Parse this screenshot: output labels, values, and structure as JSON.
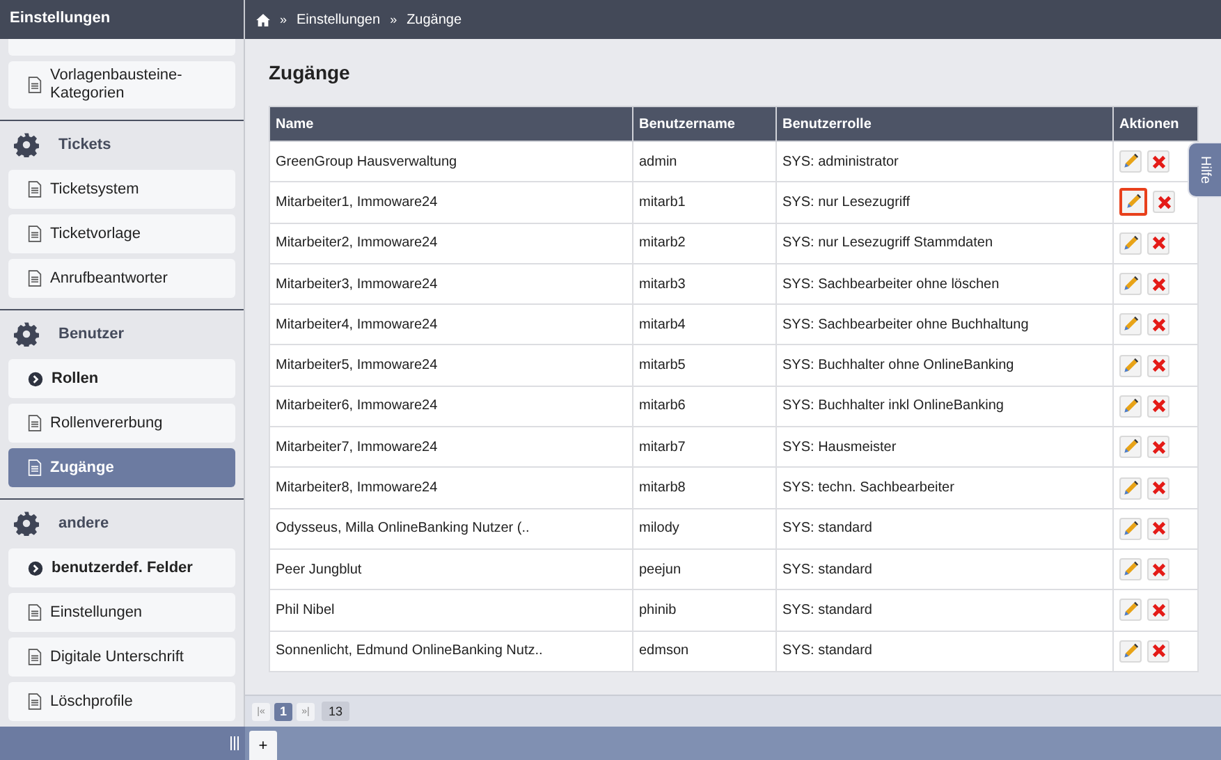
{
  "sidebar": {
    "title": "Einstellungen",
    "groups": [
      {
        "items": [
          {
            "kind": "doc",
            "label": "Vorlagenbausteine-Kategorien",
            "selected": false
          }
        ]
      },
      {
        "label": "Tickets",
        "items": [
          {
            "kind": "doc",
            "label": "Ticketsystem",
            "selected": false
          },
          {
            "kind": "doc",
            "label": "Ticketvorlage",
            "selected": false
          },
          {
            "kind": "doc",
            "label": "Anrufbeantworter",
            "selected": false
          }
        ]
      },
      {
        "label": "Benutzer",
        "items": [
          {
            "kind": "sub",
            "label": "Rollen",
            "selected": false
          },
          {
            "kind": "doc",
            "label": "Rollenvererbung",
            "selected": false
          },
          {
            "kind": "doc",
            "label": "Zugänge",
            "selected": true
          }
        ]
      },
      {
        "label": "andere",
        "items": [
          {
            "kind": "sub",
            "label": "benutzerdef. Felder",
            "selected": false
          },
          {
            "kind": "doc",
            "label": "Einstellungen",
            "selected": false
          },
          {
            "kind": "doc",
            "label": "Digitale Unterschrift",
            "selected": false
          },
          {
            "kind": "doc",
            "label": "Löschprofile",
            "selected": false
          }
        ]
      }
    ]
  },
  "breadcrumb": [
    "Einstellungen",
    "Zugänge"
  ],
  "breadcrumb_separator": "»",
  "page_title": "Zugänge",
  "help_tab": "Hilfe",
  "table": {
    "columns": [
      "Name",
      "Benutzername",
      "Benutzerrolle",
      "Aktionen"
    ],
    "rows": [
      {
        "name": "GreenGroup Hausverwaltung",
        "username": "admin",
        "role": "SYS: administrator",
        "edit_focused": false
      },
      {
        "name": "Mitarbeiter1, Immoware24",
        "username": "mitarb1",
        "role": "SYS: nur Lesezugriff",
        "edit_focused": true
      },
      {
        "name": "Mitarbeiter2, Immoware24",
        "username": "mitarb2",
        "role": "SYS: nur Lesezugriff Stammdaten",
        "edit_focused": false
      },
      {
        "name": "Mitarbeiter3, Immoware24",
        "username": "mitarb3",
        "role": "SYS: Sachbearbeiter ohne löschen",
        "edit_focused": false
      },
      {
        "name": "Mitarbeiter4, Immoware24",
        "username": "mitarb4",
        "role": "SYS: Sachbearbeiter ohne Buchhaltung",
        "edit_focused": false
      },
      {
        "name": "Mitarbeiter5, Immoware24",
        "username": "mitarb5",
        "role": "SYS: Buchhalter ohne OnlineBanking",
        "edit_focused": false
      },
      {
        "name": "Mitarbeiter6, Immoware24",
        "username": "mitarb6",
        "role": "SYS: Buchhalter inkl OnlineBanking",
        "edit_focused": false
      },
      {
        "name": "Mitarbeiter7, Immoware24",
        "username": "mitarb7",
        "role": "SYS: Hausmeister",
        "edit_focused": false
      },
      {
        "name": "Mitarbeiter8, Immoware24",
        "username": "mitarb8",
        "role": "SYS: techn. Sachbearbeiter",
        "edit_focused": false
      },
      {
        "name": "Odysseus, Milla OnlineBanking Nutzer (..",
        "username": "milody",
        "role": "SYS: standard",
        "edit_focused": false
      },
      {
        "name": "Peer Jungblut",
        "username": "peejun",
        "role": "SYS: standard",
        "edit_focused": false
      },
      {
        "name": "Phil Nibel",
        "username": "phinib",
        "role": "SYS: standard",
        "edit_focused": false
      },
      {
        "name": "Sonnenlicht, Edmund OnlineBanking Nutz..",
        "username": "edmson",
        "role": "SYS: standard",
        "edit_focused": false
      }
    ]
  },
  "pagination": {
    "first": "|«",
    "page": "1",
    "last": "»|",
    "count": "13"
  },
  "bottom_tab": "+"
}
